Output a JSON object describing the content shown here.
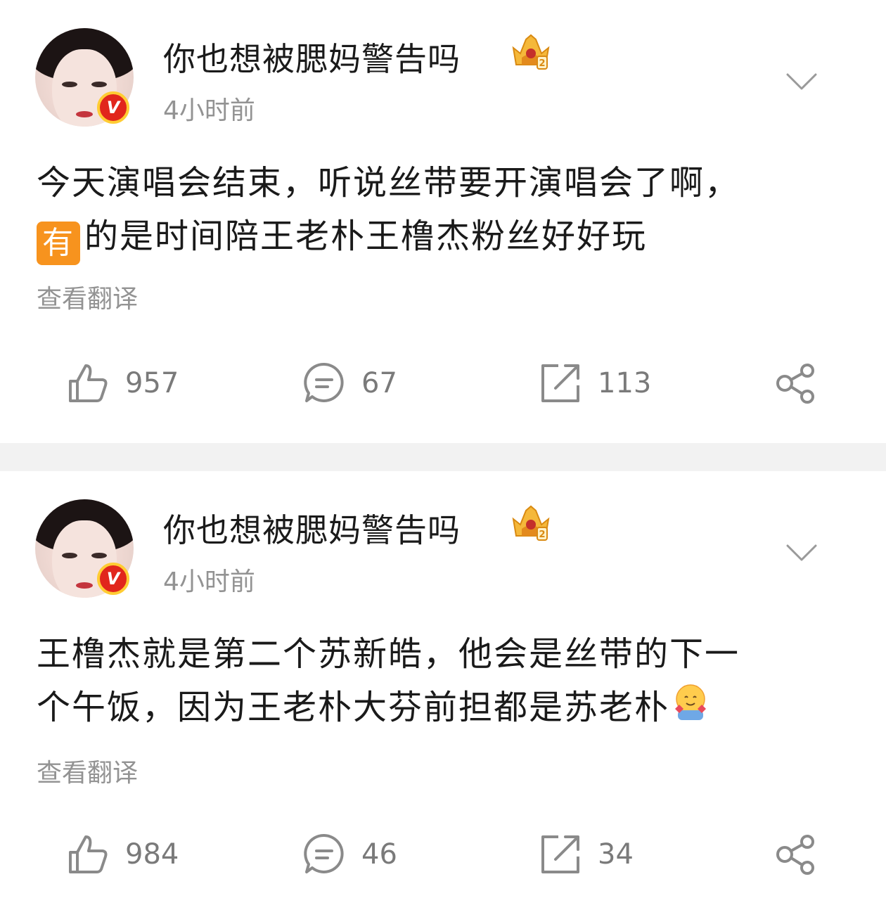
{
  "posts": [
    {
      "username": "你也想被腮妈警告吗",
      "timestamp": "4小时前",
      "content_line1": "今天演唱会结束，听说丝带要开演唱会了啊，",
      "badge_char": "有",
      "content_line2": "的是时间陪王老朴王橹杰粉丝好好玩",
      "translate_label": "查看翻译",
      "likes": "957",
      "comments": "67",
      "reposts": "113"
    },
    {
      "username": "你也想被腮妈警告吗",
      "timestamp": "4小时前",
      "content_line1": "王橹杰就是第二个苏新皓，他会是丝带的下一",
      "content_line2": "个午饭，因为王老朴大芬前担都是苏老朴",
      "translate_label": "查看翻译",
      "likes": "984",
      "comments": "46",
      "reposts": "34"
    }
  ],
  "icons": {
    "verified": "verified-v-icon",
    "member": "crown-badge-icon",
    "menu": "chevron-down-icon",
    "like": "thumbs-up-icon",
    "comment": "comment-bubble-icon",
    "repost": "repost-icon",
    "share": "share-icon",
    "emoji": "hugging-face-icon"
  },
  "colors": {
    "text": "#1a1a1a",
    "muted": "#939393",
    "icon": "#8a8a8a",
    "separator": "#f2f2f2",
    "badge_orange": "#f7931e",
    "verified_red": "#e1261c"
  }
}
